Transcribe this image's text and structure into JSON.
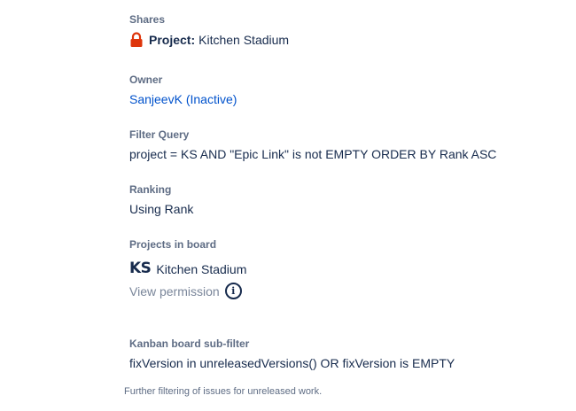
{
  "shares": {
    "label": "Shares",
    "icon": "lock-icon",
    "icon_color": "#de350b",
    "prefix": "Project:",
    "value": "Kitchen Stadium"
  },
  "owner": {
    "label": "Owner",
    "value": "SanjeevK (Inactive)"
  },
  "filter_query": {
    "label": "Filter Query",
    "value": "project = KS AND \"Epic Link\" is not EMPTY ORDER BY Rank ASC"
  },
  "ranking": {
    "label": "Ranking",
    "value": "Using Rank"
  },
  "projects_in_board": {
    "label": "Projects in board",
    "logo_text": "KS",
    "project_name": "Kitchen Stadium",
    "permission_link": "View permission",
    "info_icon": "info-icon"
  },
  "kanban_sub_filter": {
    "label": "Kanban board sub-filter",
    "value": "fixVersion in unreleasedVersions() OR fixVersion is EMPTY",
    "helper": "Further filtering of issues for unreleased work."
  },
  "colors": {
    "label": "#5e6c84",
    "text": "#172b4d",
    "link": "#0052cc",
    "muted_link": "#7a869a"
  }
}
